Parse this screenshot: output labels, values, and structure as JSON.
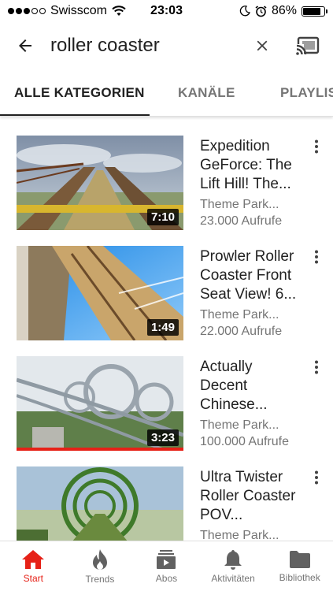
{
  "status_bar": {
    "carrier": "Swisscom",
    "time": "23:03",
    "battery": "86%",
    "battery_level": 0.86
  },
  "search": {
    "query": "roller coaster"
  },
  "tabs": [
    {
      "label": "ALLE KATEGORIEN",
      "active": true
    },
    {
      "label": "KANÄLE",
      "active": false
    },
    {
      "label": "PLAYLIS",
      "active": false
    }
  ],
  "results": [
    {
      "title": "Expedition GeForce: The Lift Hill! The...",
      "channel": "Theme Park...",
      "views": "23.000 Aufrufe",
      "duration": "7:10",
      "watched": 0
    },
    {
      "title": "Prowler Roller Coaster Front Seat View! 6...",
      "channel": "Theme Park...",
      "views": "22.000 Aufrufe",
      "duration": "1:49",
      "watched": 0
    },
    {
      "title": "Actually Decent Chinese...",
      "channel": "Theme Park...",
      "views": "100.000 Aufrufe",
      "duration": "3:23",
      "watched": 1
    },
    {
      "title": "Ultra Twister Roller Coaster POV...",
      "channel": "Theme Park...",
      "views": "",
      "duration": "",
      "watched": 0
    }
  ],
  "bottom_nav": [
    {
      "label": "Start",
      "icon": "home-icon",
      "active": true
    },
    {
      "label": "Trends",
      "icon": "flame-icon",
      "active": false
    },
    {
      "label": "Abos",
      "icon": "subscriptions-icon",
      "active": false
    },
    {
      "label": "Aktivitäten",
      "icon": "bell-icon",
      "active": false
    },
    {
      "label": "Bibliothek",
      "icon": "folder-icon",
      "active": false
    }
  ],
  "colors": {
    "accent": "#e62117",
    "text": "#212121",
    "secondary_text": "#757575"
  }
}
